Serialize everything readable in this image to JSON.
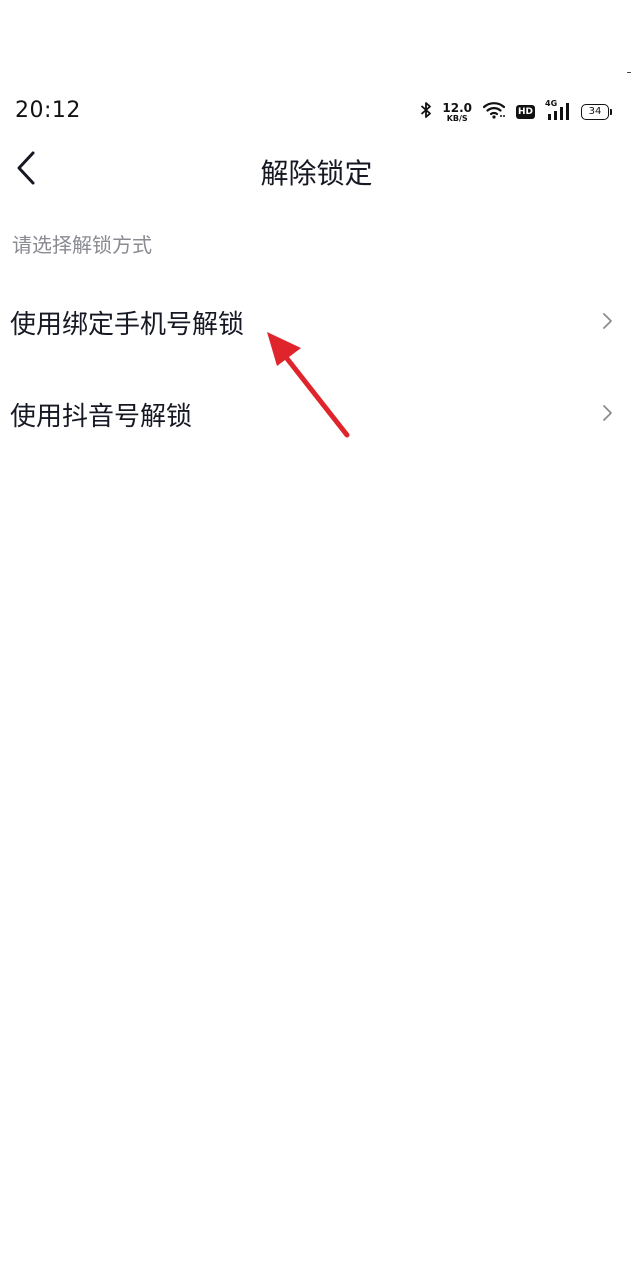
{
  "status_bar": {
    "time": "20:12",
    "net_speed_value": "12.0",
    "net_speed_unit": "KB/S",
    "hd_label": "HD",
    "network_type": "4G",
    "battery_level": "34",
    "icons": [
      "bluetooth-icon",
      "wifi-icon",
      "hd-icon",
      "signal-icon",
      "battery-icon"
    ]
  },
  "nav": {
    "title": "解除锁定",
    "back_icon": "chevron-left-icon"
  },
  "hint": "请选择解锁方式",
  "options": [
    {
      "label": "使用绑定手机号解锁",
      "icon": "chevron-right-icon"
    },
    {
      "label": "使用抖音号解锁",
      "icon": "chevron-right-icon"
    }
  ],
  "colors": {
    "annotation_arrow": "#e0242b",
    "primary_text": "#161823",
    "secondary_text": "#8a8b91"
  }
}
